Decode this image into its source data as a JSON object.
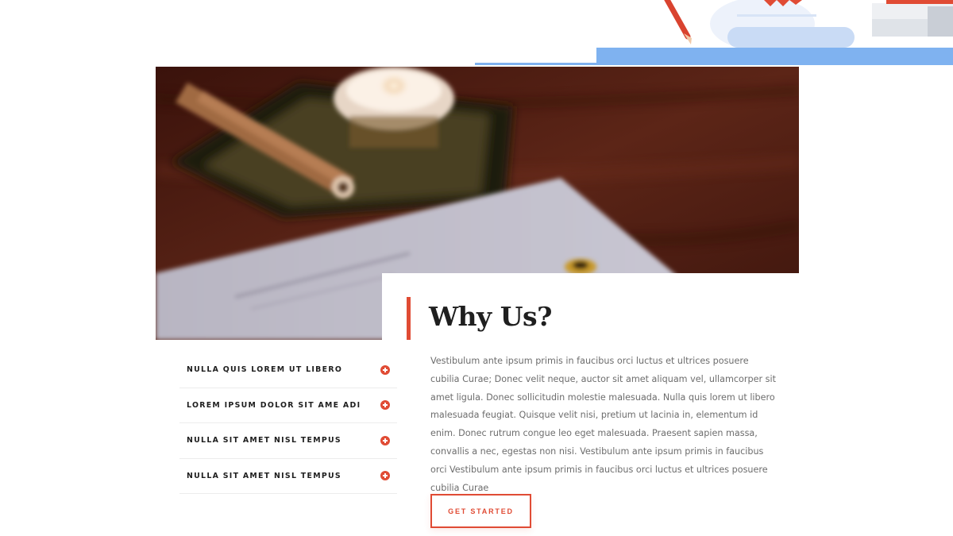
{
  "section": {
    "title": "Why Us?",
    "body": "Vestibulum ante ipsum primis in faucibus orci luctus et ultrices posuere cubilia Curae; Donec velit neque, auctor sit amet aliquam vel, ullamcorper sit amet ligula. Donec sollicitudin molestie malesuada. Nulla quis lorem ut libero malesuada feugiat. Quisque velit nisi, pretium ut lacinia in, elementum id enim. Donec rutrum congue leo eget malesuada. Praesent sapien massa, convallis a nec, egestas non nisi. Vestibulum ante ipsum primis in faucibus orci Vestibulum ante ipsum primis in faucibus orci luctus et ultrices posuere cubilia Curae",
    "cta_label": "GET STARTED"
  },
  "accordion": {
    "items": [
      {
        "label": "NULLA QUIS LOREM UT LIBERO",
        "icon": "plus-circle-icon"
      },
      {
        "label": "LOREM IPSUM DOLOR SIT AME ADI",
        "icon": "plus-circle-icon"
      },
      {
        "label": "NULLA SIT AMET NISL TEMPUS",
        "icon": "plus-circle-icon"
      },
      {
        "label": "NULLA SIT AMET NISL TEMPUS",
        "icon": "plus-circle-icon"
      }
    ]
  },
  "colors": {
    "accent": "#e04b34",
    "heading": "#1f1f1f",
    "body_text": "#6d6d6d",
    "illustration_blue": "#7fb2f0"
  }
}
